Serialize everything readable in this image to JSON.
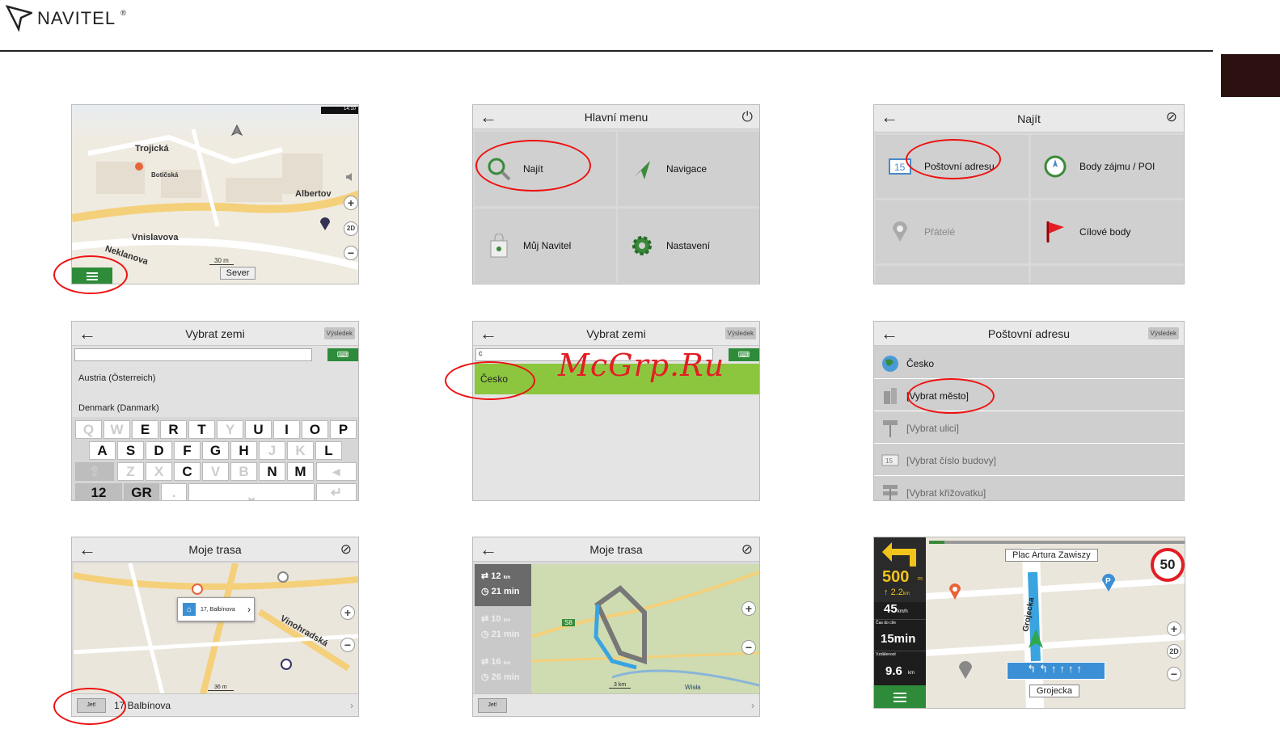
{
  "brand": {
    "name": "NAVITEL",
    "reg": "®"
  },
  "s1": {
    "status_time": "14:10",
    "streets": [
      "Trojická",
      "Botičská",
      "Albertov",
      "Vnislavova",
      "Neklanova"
    ],
    "scale": "30 m",
    "north_btn": "Sever",
    "zoom_mode": "2D"
  },
  "s2": {
    "title": "Hlavní menu",
    "tiles": [
      "Najít",
      "Navigace",
      "Můj Navitel",
      "Nastavení"
    ]
  },
  "s3": {
    "title": "Najít",
    "tiles": [
      "Poštovní adresu",
      "Body zájmu / POI",
      "Přátelé",
      "Cílové body"
    ]
  },
  "s4": {
    "title": "Vybrat zemi",
    "result_btn": "Výsledek",
    "items": [
      "Austria (Österreich)",
      "Denmark (Danmark)"
    ],
    "keys_row1": [
      "Q",
      "W",
      "E",
      "R",
      "T",
      "Y",
      "U",
      "I",
      "O",
      "P"
    ],
    "keys_row2": [
      "A",
      "S",
      "D",
      "F",
      "G",
      "H",
      "J",
      "K",
      "L"
    ],
    "keys_row3": [
      "Z",
      "X",
      "C",
      "V",
      "B",
      "N",
      "M"
    ],
    "key_num": "12",
    "key_lang": "GR"
  },
  "s5": {
    "title": "Vybrat zemi",
    "result_btn": "Výsledek",
    "input": "c",
    "item": "Česko"
  },
  "s6": {
    "title": "Poštovní adresu",
    "result_btn": "Výsledek",
    "items": [
      "Česko",
      "[Vybrat město]",
      "[Vybrat ulici]",
      "[Vybrat číslo budovy]",
      "[Vybrat křižovatku]"
    ]
  },
  "s7": {
    "title": "Moje trasa",
    "popup": "17, Balbínova",
    "streets": [
      "Vinohradská"
    ],
    "scale": "36 m",
    "jet": "Jet!",
    "address": "17 Balbínova"
  },
  "s8": {
    "title": "Moje trasa",
    "routes": [
      {
        "dist": "12",
        "unit": "km",
        "time": "21 min"
      },
      {
        "dist": "10",
        "unit": "km",
        "time": "21 min"
      },
      {
        "dist": "16",
        "unit": "km",
        "time": "26 min"
      }
    ],
    "road": "S8",
    "scale": "3 km",
    "place": "Wisła",
    "jet": "Jet!"
  },
  "s9": {
    "top_street": "Plac Artura Zawiszy",
    "turn_dist": "500",
    "turn_unit": "m",
    "next_dist": "2.2",
    "next_unit": "km",
    "speed": "45",
    "speed_unit": "km/h",
    "eta_label": "Čas do cíle",
    "eta": "15min",
    "remain_label": "Vzdálenost",
    "remain": "9.6",
    "remain_unit": "km",
    "speed_limit": "50",
    "road": "Grojecka",
    "side_street": "Grojecka",
    "zoom_mode": "2D"
  },
  "watermark": "McGrp.Ru"
}
